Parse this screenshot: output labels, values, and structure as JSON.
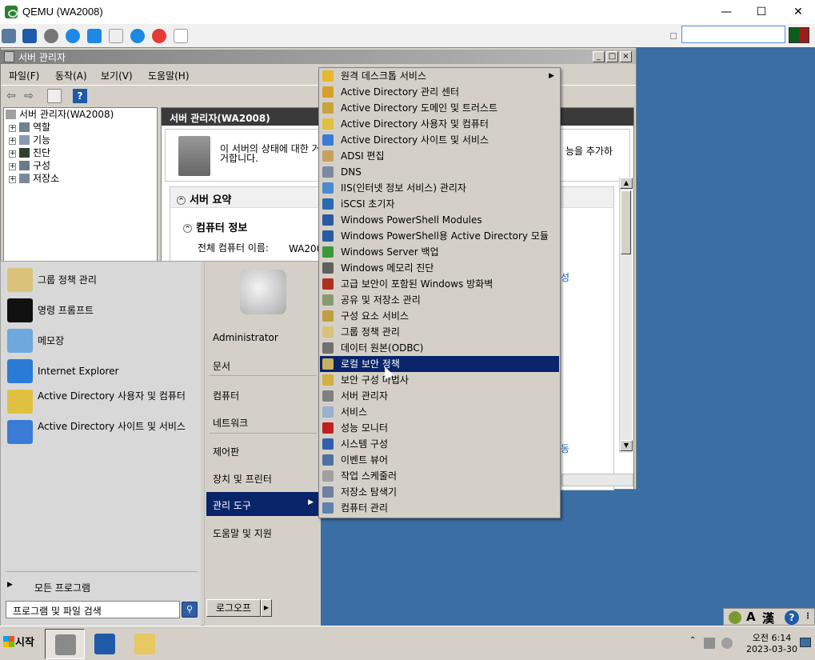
{
  "qemu": {
    "title": "QEMU (WA2008)",
    "minimize": "—",
    "maximize": "☐",
    "close": "✕",
    "color_left": "#0a5d1c",
    "color_right": "#9c1b1b"
  },
  "server_manager": {
    "title": "서버 관리자",
    "menus": [
      "파일(F)",
      "동작(A)",
      "보기(V)",
      "도움말(H)"
    ],
    "tree": [
      {
        "label": "서버 관리자(WA2008)",
        "expander": ""
      },
      {
        "label": "역할",
        "expander": "+"
      },
      {
        "label": "기능",
        "expander": "+"
      },
      {
        "label": "진단",
        "expander": "+"
      },
      {
        "label": "구성",
        "expander": "+"
      },
      {
        "label": "저장소",
        "expander": "+"
      }
    ],
    "content_title": "서버 관리자(WA2008)",
    "description": "이 서버의 상태에 대한 거나 제거합니다.",
    "description_tail": "능을 추가하",
    "summary_title": "서버 요약",
    "computer_info_title": "컴퓨터 정보",
    "full_name_label": "전체 컴퓨터 이름:",
    "full_name_value": "WA200",
    "link_partial_1": "성",
    "link_partial_2": "동"
  },
  "start_menu": {
    "pinned": [
      {
        "label": "그룹 정책 관리",
        "icon": "group-policy-icon",
        "color": "#d9c27a"
      },
      {
        "label": "명령 프롬프트",
        "icon": "command-prompt-icon",
        "color": "#111111"
      },
      {
        "label": "메모장",
        "icon": "notepad-icon",
        "color": "#6fa8dc"
      },
      {
        "label": "Internet Explorer",
        "icon": "internet-explorer-icon",
        "color": "#2a7bd6"
      },
      {
        "label": "Active Directory 사용자 및 컴퓨터",
        "icon": "ad-users-icon",
        "color": "#e0c040"
      },
      {
        "label": "Active Directory 사이트 및 서비스",
        "icon": "ad-sites-icon",
        "color": "#3a7bd5"
      }
    ],
    "all_programs": "모든 프로그램",
    "search_placeholder": "프로그램 및 파일 검색",
    "right_items": [
      {
        "label": "Administrator"
      },
      {
        "label": "문서"
      },
      {
        "label": "컴퓨터"
      },
      {
        "label": "네트워크"
      },
      {
        "label": "제어판"
      },
      {
        "label": "장치 및 프린터"
      },
      {
        "label": "관리 도구"
      },
      {
        "label": "도움말 및 지원"
      }
    ],
    "logoff": "로그오프"
  },
  "admin_tools": [
    {
      "label": "원격 데스크톱 서비스",
      "color": "#e8b830",
      "submenu": true
    },
    {
      "label": "Active Directory 관리 센터",
      "color": "#d6a02a"
    },
    {
      "label": "Active Directory 도메인 및 트러스트",
      "color": "#c9a43a"
    },
    {
      "label": "Active Directory 사용자 및 컴퓨터",
      "color": "#e0c040"
    },
    {
      "label": "Active Directory 사이트 및 서비스",
      "color": "#3a7bd5"
    },
    {
      "label": "ADSI 편집",
      "color": "#c8a060"
    },
    {
      "label": "DNS",
      "color": "#7a8aa0"
    },
    {
      "label": "IIS(인터넷 정보 서비스) 관리자",
      "color": "#4a8ad0"
    },
    {
      "label": "iSCSI 초기자",
      "color": "#2a6ab0"
    },
    {
      "label": "Windows PowerShell Modules",
      "color": "#2a5aa0"
    },
    {
      "label": "Windows PowerShell용 Active Directory 모듈",
      "color": "#2a5aa0"
    },
    {
      "label": "Windows Server 백업",
      "color": "#3a9a3a"
    },
    {
      "label": "Windows 메모리 진단",
      "color": "#606060"
    },
    {
      "label": "고급 보안이 포함된 Windows 방화벽",
      "color": "#b03020"
    },
    {
      "label": "공유 및 저장소 관리",
      "color": "#8a9a70"
    },
    {
      "label": "구성 요소 서비스",
      "color": "#c0a040"
    },
    {
      "label": "그룹 정책 관리",
      "color": "#d9c27a"
    },
    {
      "label": "데이터 원본(ODBC)",
      "color": "#707070"
    },
    {
      "label": "로컬 보안 정책",
      "color": "#c8b060"
    },
    {
      "label": "보안 구성 마법사",
      "color": "#d0b040"
    },
    {
      "label": "서버 관리자",
      "color": "#808080"
    },
    {
      "label": "서비스",
      "color": "#9ab0d0"
    },
    {
      "label": "성능 모니터",
      "color": "#c02020"
    },
    {
      "label": "시스템 구성",
      "color": "#3060b0"
    },
    {
      "label": "이벤트 뷰어",
      "color": "#5070a0"
    },
    {
      "label": "작업 스케줄러",
      "color": "#a0a0a0"
    },
    {
      "label": "저장소 탐색기",
      "color": "#7080a0"
    },
    {
      "label": "컴퓨터 관리",
      "color": "#6080b0"
    }
  ],
  "admin_selected": "로컬 보안 정책",
  "langbar": {
    "mode": "A",
    "hanja": "漢",
    "help": "?"
  },
  "taskbar": {
    "start_label": "시작",
    "clock_time": "오전 6:14",
    "clock_date": "2023-03-30"
  }
}
